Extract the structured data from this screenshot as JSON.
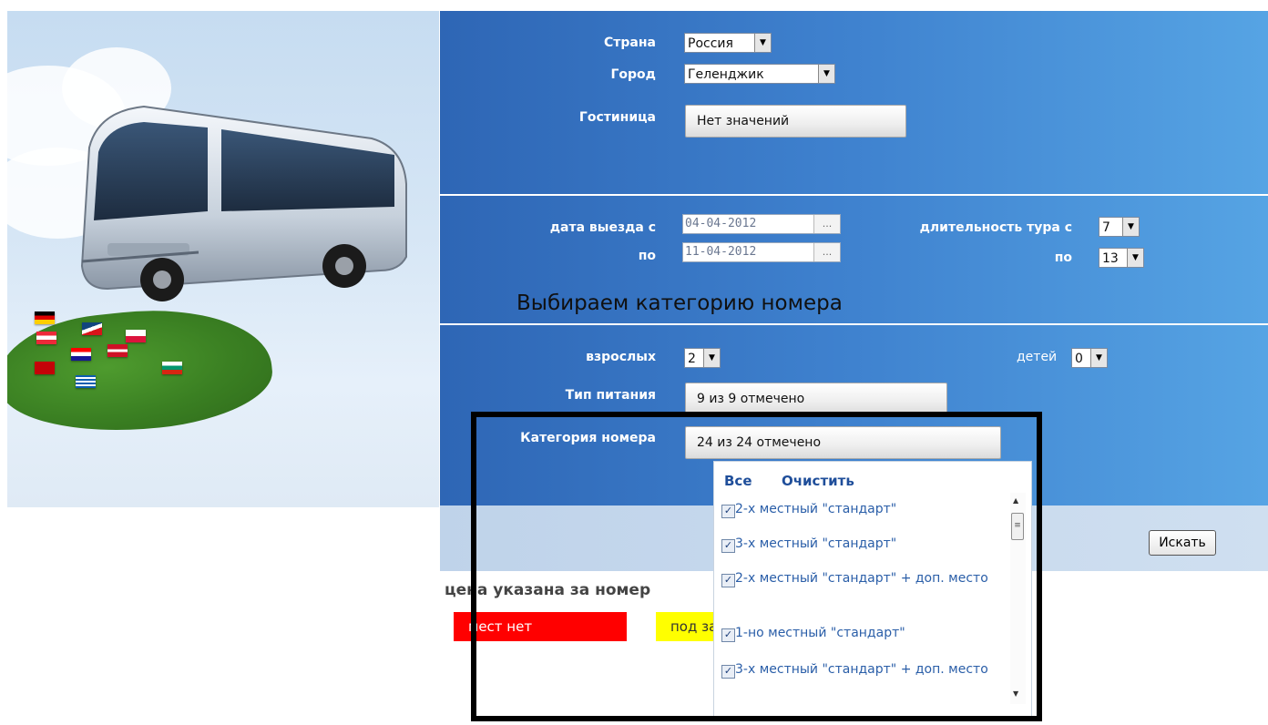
{
  "search": {
    "country_label": "Страна",
    "country_value": "Россия",
    "city_label": "Город",
    "city_value": "Геленджик",
    "hotel_label": "Гостиница",
    "hotel_value": "Нет значений"
  },
  "dates": {
    "departure_from_label": "дата выезда с",
    "departure_from_value": "04-04-2012",
    "departure_to_label": "по",
    "departure_to_value": "11-04-2012",
    "duration_from_label": "длительность тура с",
    "duration_from_value": "7",
    "duration_to_label": "по",
    "duration_to_value": "13",
    "picker_label": "..."
  },
  "annotation": "Выбираем категорию номера",
  "guests": {
    "adults_label": "взрослых",
    "adults_value": "2",
    "children_label": "детей",
    "children_value": "0",
    "meal_label": "Тип питания",
    "meal_value": "9 из 9 отмечено",
    "room_category_label": "Категория номера",
    "room_category_value": "24 из 24 отмечено"
  },
  "search_button": "Искать",
  "price_note": "цена указана за номер",
  "legend": {
    "no_places": "мест нет",
    "on_request": "под запрос"
  },
  "room_dropdown": {
    "all": "Все",
    "clear": "Очистить",
    "items": [
      {
        "label": "2-х местный \"стандарт\"",
        "checked": true
      },
      {
        "label": "3-х местный \"стандарт\"",
        "checked": true
      },
      {
        "label": "2-х местный \"стандарт\" + доп. место",
        "checked": true
      },
      {
        "label": "1-но местный \"стандарт\"",
        "checked": true
      },
      {
        "label": "3-х местный \"стандарт\" + доп. место",
        "checked": true
      }
    ]
  },
  "colors": {
    "panel_blue": "#3f82cf",
    "legend_red": "#ff0000",
    "legend_yellow": "#ffff00",
    "link_blue": "#1f4e9a"
  }
}
